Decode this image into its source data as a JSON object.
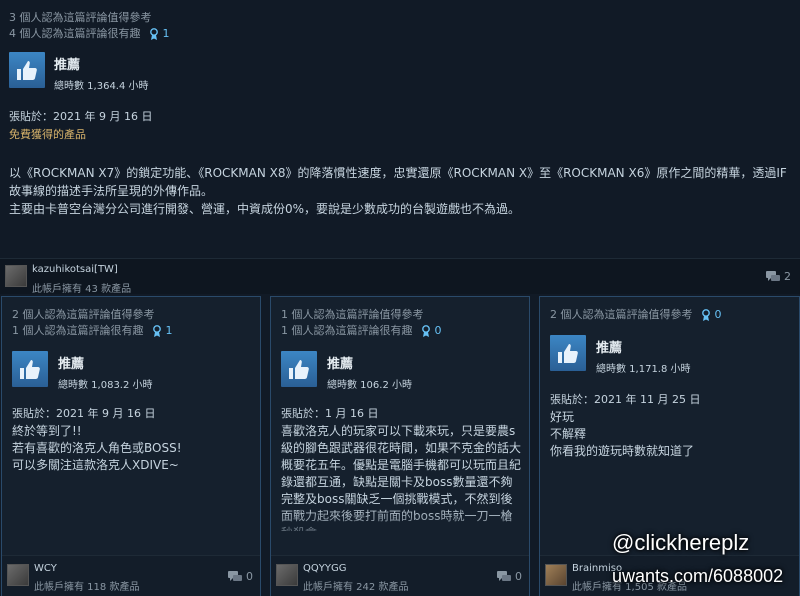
{
  "top_review": {
    "helpful_line": "3 個人認為這篇評論值得參考",
    "funny_line": "4 個人認為這篇評論很有趣",
    "award_count": "1",
    "recommendation": "推薦",
    "hours": "總時數 1,364.4 小時",
    "posted": "張貼於：2021 年 9 月 16 日",
    "free_product": "免費獲得的產品",
    "body_line1": "以《ROCKMAN X7》的鎖定功能、《ROCKMAN X8》的降落慣性速度，忠實還原《ROCKMAN X》至《ROCKMAN X6》原作之間的精華，透過IF",
    "body_line2": "故事線的描述手法所呈現的外傳作品。",
    "body_line3": "主要由卡普空台灣分公司進行開發、營運，中資成份0%，要說是少數成功的台製遊戲也不為過。",
    "author": "kazuhikotsai[TW]",
    "owns": "此帳戶擁有 43 款產品",
    "comments": "2"
  },
  "cards": [
    {
      "helpful_line": "2 個人認為這篇評論值得參考",
      "funny_line": "1 個人認為這篇評論很有趣",
      "award_count": "1",
      "recommendation": "推薦",
      "hours": "總時數 1,083.2 小時",
      "posted": "張貼於：2021 年 9 月 16 日",
      "body": "終於等到了!!\n若有喜歡的洛克人角色或BOSS!\n可以多關注這款洛克人XDIVE~",
      "author": "WCY",
      "owns": "此帳戶擁有 118 款產品",
      "comments": "0"
    },
    {
      "helpful_line": "1 個人認為這篇評論值得參考",
      "funny_line": "1 個人認為這篇評論很有趣",
      "award_count": "0",
      "recommendation": "推薦",
      "hours": "總時數 106.2 小時",
      "posted": "張貼於：1 月 16 日",
      "body": "喜歡洛克人的玩家可以下載來玩，只是要農s級的腳色跟武器很花時間，如果不克金的話大概要花五年。優點是電腦手機都可以玩而且紀錄還都互通，缺點是關卡及boss數量還不夠完整及boss關缺乏一個挑戰模式，不然到後面戰力起來後要打前面的boss時就一刀一槍秒殺會",
      "author": "QQYYGG",
      "owns": "此帳戶擁有 242 款產品",
      "comments": "0"
    },
    {
      "helpful_line": "2 個人認為這篇評論值得參考",
      "funny_line": "",
      "award_count": "0",
      "recommendation": "推薦",
      "hours": "總時數 1,171.8 小時",
      "posted": "張貼於：2021 年 11 月 25 日",
      "body": "好玩\n不解釋\n你看我的遊玩時數就知道了",
      "author": "Brainmiso",
      "owns": "此帳戶擁有 1,505 款產品",
      "comments": "0"
    }
  ],
  "watermark": {
    "handle": "@clickhereplz",
    "url": "uwants.com/6088002"
  }
}
